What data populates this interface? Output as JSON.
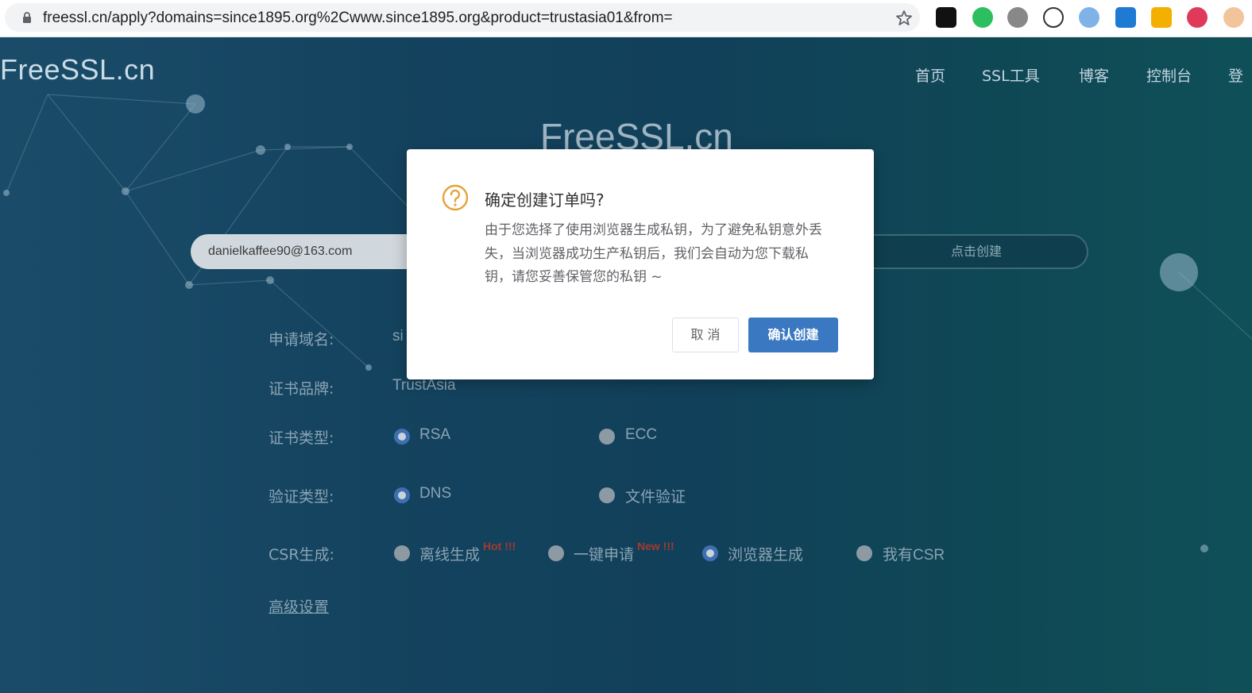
{
  "browser": {
    "url": "freessl.cn/apply?domains=since1895.org%2Cwww.since1895.org&product=trustasia01&from=",
    "extensions": [
      "ghost-extension-icon",
      "evernote-icon",
      "globe-mask-icon",
      "info-circle-icon",
      "sphere-icon",
      "paper-plane-icon",
      "shield-icon",
      "color-wheel-icon",
      "avatar-icon"
    ]
  },
  "site": {
    "logo": "FreeSSL.cn",
    "nav": [
      "首页",
      "SSL工具",
      "博客",
      "控制台",
      "登"
    ],
    "hero_title": "FreeSSL.cn"
  },
  "apply": {
    "email": "danielkaffee90@163.com",
    "create_button": "点击创建"
  },
  "form": {
    "domain_label": "申请域名:",
    "domain_value": "si",
    "brand_label": "证书品牌:",
    "brand_value": "TrustAsia",
    "cert_type_label": "证书类型:",
    "cert_type_options": [
      "RSA",
      "ECC"
    ],
    "cert_type_selected": "RSA",
    "verify_type_label": "验证类型:",
    "verify_type_options": [
      "DNS",
      "文件验证"
    ],
    "verify_type_selected": "DNS",
    "csr_label": "CSR生成:",
    "csr_options": [
      "离线生成",
      "一键申请",
      "浏览器生成",
      "我有CSR"
    ],
    "csr_tags": [
      "Hot !!!",
      "New !!!"
    ],
    "csr_selected": "浏览器生成",
    "advanced_link": "高级设置"
  },
  "modal": {
    "title": "确定创建订单吗?",
    "body": "由于您选择了使用浏览器生成私钥，为了避免私钥意外丢失，当浏览器成功生产私钥后，我们会自动为您下载私钥，请您妥善保管您的私钥 ~",
    "cancel": "取 消",
    "confirm": "确认创建"
  },
  "colors": {
    "background": "#14435f",
    "primary": "#3a78c2",
    "warning": "#e6a23c",
    "hot_tag": "#a33a2e"
  }
}
